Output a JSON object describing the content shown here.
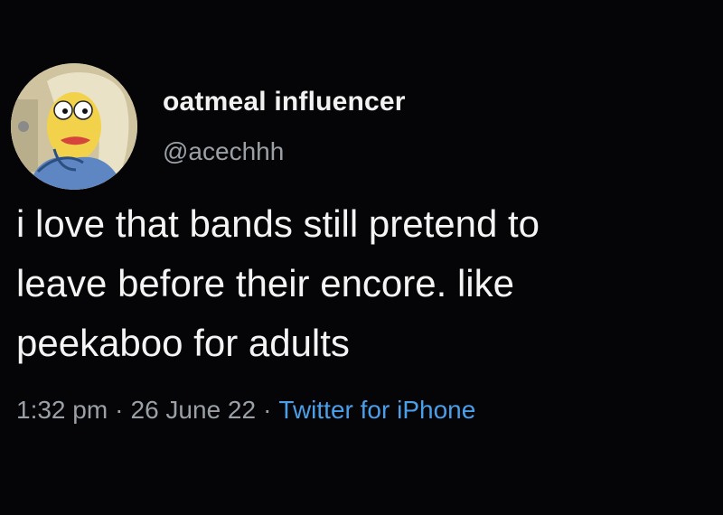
{
  "author": {
    "display_name": "oatmeal influencer",
    "handle": "@acechhh",
    "avatar_icon": "cartoon-character-avatar"
  },
  "tweet": {
    "lines": [
      "i love that bands still pretend to",
      "leave before their encore. like",
      "peekaboo for adults"
    ]
  },
  "meta": {
    "time": "1:32 pm",
    "separator": "·",
    "date": "26 June 22",
    "source": "Twitter for iPhone"
  },
  "colors": {
    "background": "#050507",
    "text": "#f4f4f4",
    "secondary": "#9aa0a6",
    "link": "#4b9ee8"
  }
}
